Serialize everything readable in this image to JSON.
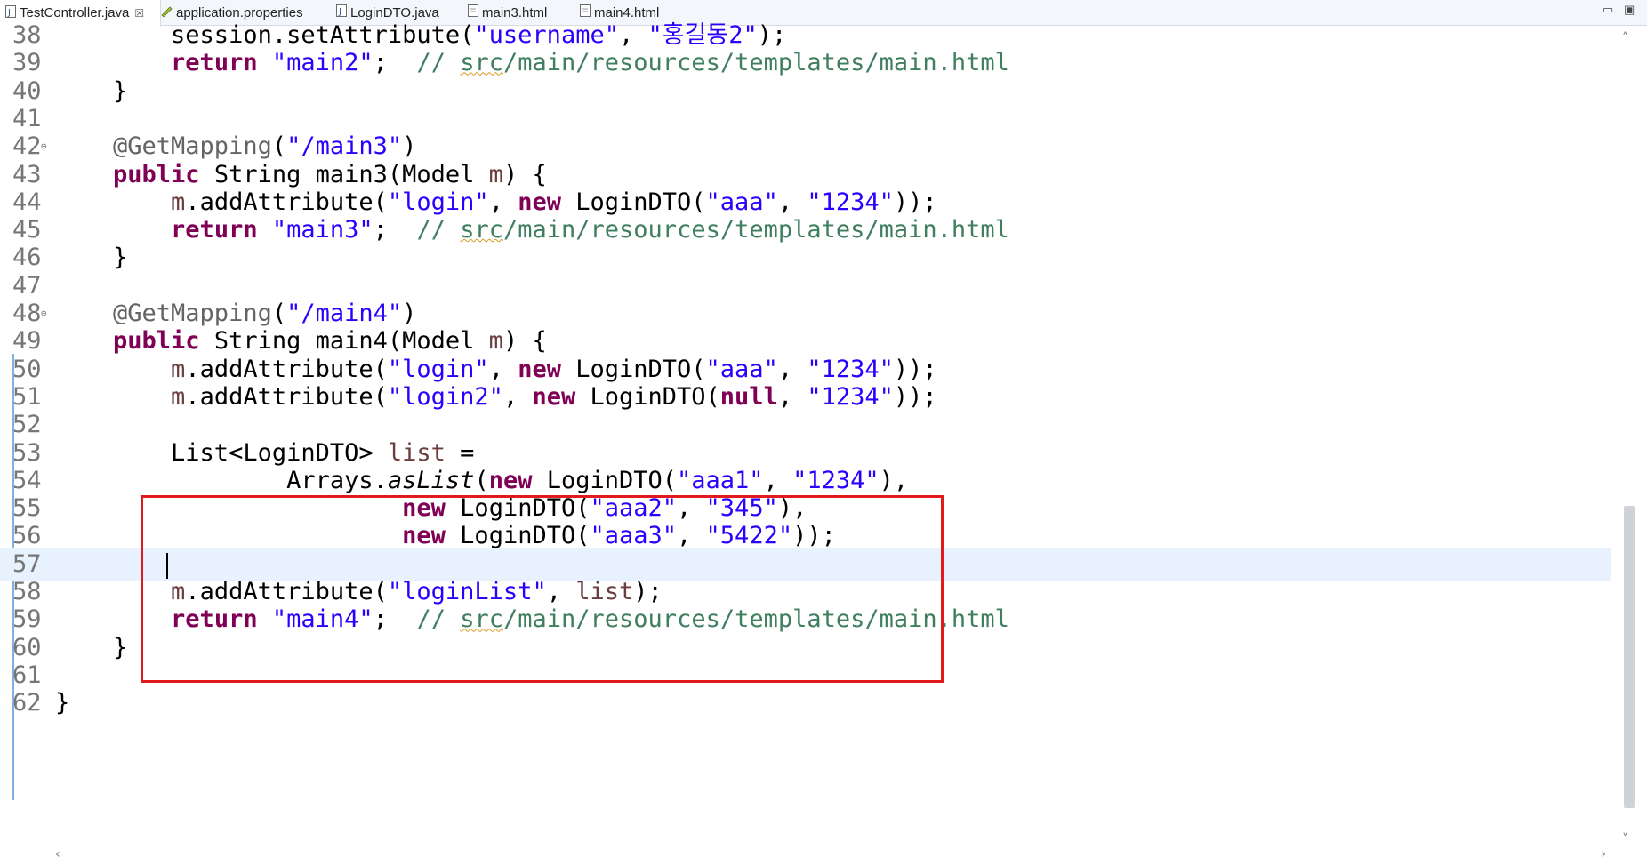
{
  "tabs": [
    {
      "label": "TestController.java",
      "icon": "java-file-icon",
      "active": true,
      "close": "☒"
    },
    {
      "label": "application.properties",
      "icon": "properties-file-icon"
    },
    {
      "label": "LoginDTO.java",
      "icon": "java-file-icon"
    },
    {
      "label": "main3.html",
      "icon": "html-file-icon"
    },
    {
      "label": "main4.html",
      "icon": "html-file-icon"
    }
  ],
  "window_controls": {
    "minimize": "▭",
    "maximize": "▣"
  },
  "lines": [
    {
      "n": "38",
      "t": [
        [
          "",
          "        session.setAttribute("
        ],
        [
          "str",
          "\"username\""
        ],
        [
          "",
          ", "
        ],
        [
          "str",
          "\"홍길동2\""
        ],
        [
          "",
          ");"
        ]
      ]
    },
    {
      "n": "39",
      "t": [
        [
          "",
          "        "
        ],
        [
          "kw",
          "return"
        ],
        [
          "",
          " "
        ],
        [
          "str",
          "\"main2\""
        ],
        [
          "",
          ";  "
        ],
        [
          "cm",
          "// "
        ],
        [
          "cm sq",
          "src"
        ],
        [
          "cm",
          "/main/resources/templates/main.html"
        ]
      ]
    },
    {
      "n": "40",
      "t": [
        [
          "",
          "    }"
        ]
      ]
    },
    {
      "n": "41",
      "t": []
    },
    {
      "n": "42",
      "fold": "⊖",
      "t": [
        [
          "ann",
          "    @GetMapping"
        ],
        [
          "",
          "("
        ],
        [
          "str",
          "\"/main3\""
        ],
        [
          "",
          ")"
        ]
      ]
    },
    {
      "n": "43",
      "t": [
        [
          "kw",
          "    public"
        ],
        [
          "",
          " String main3(Model "
        ],
        [
          "var",
          "m"
        ],
        [
          "",
          ") {"
        ]
      ]
    },
    {
      "n": "44",
      "t": [
        [
          "var",
          "        m"
        ],
        [
          "",
          ".addAttribute("
        ],
        [
          "str",
          "\"login\""
        ],
        [
          "",
          ", "
        ],
        [
          "kw",
          "new"
        ],
        [
          "",
          " LoginDTO("
        ],
        [
          "str",
          "\"aaa\""
        ],
        [
          "",
          ", "
        ],
        [
          "str",
          "\"1234\""
        ],
        [
          "",
          "));"
        ]
      ]
    },
    {
      "n": "45",
      "t": [
        [
          "",
          "        "
        ],
        [
          "kw",
          "return"
        ],
        [
          "",
          " "
        ],
        [
          "str",
          "\"main3\""
        ],
        [
          "",
          ";  "
        ],
        [
          "cm",
          "// "
        ],
        [
          "cm sq",
          "src"
        ],
        [
          "cm",
          "/main/resources/templates/main.html"
        ]
      ]
    },
    {
      "n": "46",
      "t": [
        [
          "",
          "    }"
        ]
      ]
    },
    {
      "n": "47",
      "t": []
    },
    {
      "n": "48",
      "fold": "⊖",
      "t": [
        [
          "ann",
          "    @GetMapping"
        ],
        [
          "",
          "("
        ],
        [
          "str",
          "\"/main4\""
        ],
        [
          "",
          ")"
        ]
      ]
    },
    {
      "n": "49",
      "t": [
        [
          "kw",
          "    public"
        ],
        [
          "",
          " String main4(Model "
        ],
        [
          "var",
          "m"
        ],
        [
          "",
          ") {"
        ]
      ]
    },
    {
      "n": "50",
      "t": [
        [
          "var",
          "        m"
        ],
        [
          "",
          ".addAttribute("
        ],
        [
          "str",
          "\"login\""
        ],
        [
          "",
          ", "
        ],
        [
          "kw",
          "new"
        ],
        [
          "",
          " LoginDTO("
        ],
        [
          "str",
          "\"aaa\""
        ],
        [
          "",
          ", "
        ],
        [
          "str",
          "\"1234\""
        ],
        [
          "",
          "));"
        ]
      ]
    },
    {
      "n": "51",
      "t": [
        [
          "var",
          "        m"
        ],
        [
          "",
          ".addAttribute("
        ],
        [
          "str",
          "\"login2\""
        ],
        [
          "",
          ", "
        ],
        [
          "kw",
          "new"
        ],
        [
          "",
          " LoginDTO("
        ],
        [
          "kw",
          "null"
        ],
        [
          "",
          ", "
        ],
        [
          "str",
          "\"1234\""
        ],
        [
          "",
          "));"
        ]
      ]
    },
    {
      "n": "52",
      "t": []
    },
    {
      "n": "53",
      "t": [
        [
          "",
          "        List<LoginDTO> "
        ],
        [
          "var",
          "list"
        ],
        [
          "",
          " ="
        ]
      ]
    },
    {
      "n": "54",
      "t": [
        [
          "",
          "                Arrays."
        ],
        [
          "it",
          "asList"
        ],
        [
          "",
          "("
        ],
        [
          "kw",
          "new"
        ],
        [
          "",
          " LoginDTO("
        ],
        [
          "str",
          "\"aaa1\""
        ],
        [
          "",
          ", "
        ],
        [
          "str",
          "\"1234\""
        ],
        [
          "",
          "),"
        ]
      ]
    },
    {
      "n": "55",
      "t": [
        [
          "",
          "                        "
        ],
        [
          "kw",
          "new"
        ],
        [
          "",
          " LoginDTO("
        ],
        [
          "str",
          "\"aaa2\""
        ],
        [
          "",
          ", "
        ],
        [
          "str",
          "\"345\""
        ],
        [
          "",
          "),"
        ]
      ]
    },
    {
      "n": "56",
      "t": [
        [
          "",
          "                        "
        ],
        [
          "kw",
          "new"
        ],
        [
          "",
          " LoginDTO("
        ],
        [
          "str",
          "\"aaa3\""
        ],
        [
          "",
          ", "
        ],
        [
          "str",
          "\"5422\""
        ],
        [
          "",
          "));"
        ]
      ]
    },
    {
      "n": "57",
      "current": true,
      "t": []
    },
    {
      "n": "58",
      "t": [
        [
          "var",
          "        m"
        ],
        [
          "",
          ".addAttribute("
        ],
        [
          "str",
          "\"loginList\""
        ],
        [
          "",
          ", "
        ],
        [
          "var",
          "list"
        ],
        [
          "",
          ");"
        ]
      ]
    },
    {
      "n": "59",
      "t": [
        [
          "",
          "        "
        ],
        [
          "kw",
          "return"
        ],
        [
          "",
          " "
        ],
        [
          "str",
          "\"main4\""
        ],
        [
          "",
          ";  "
        ],
        [
          "cm",
          "// "
        ],
        [
          "cm sq",
          "src"
        ],
        [
          "cm",
          "/main/resources/templates/main.html"
        ]
      ]
    },
    {
      "n": "60",
      "t": [
        [
          "",
          "    }"
        ]
      ]
    },
    {
      "n": "61",
      "t": []
    },
    {
      "n": "62",
      "t": [
        [
          "",
          "}"
        ]
      ]
    }
  ],
  "scroll": {
    "up": "˄",
    "down": "˅",
    "left": "‹",
    "right": "›"
  }
}
